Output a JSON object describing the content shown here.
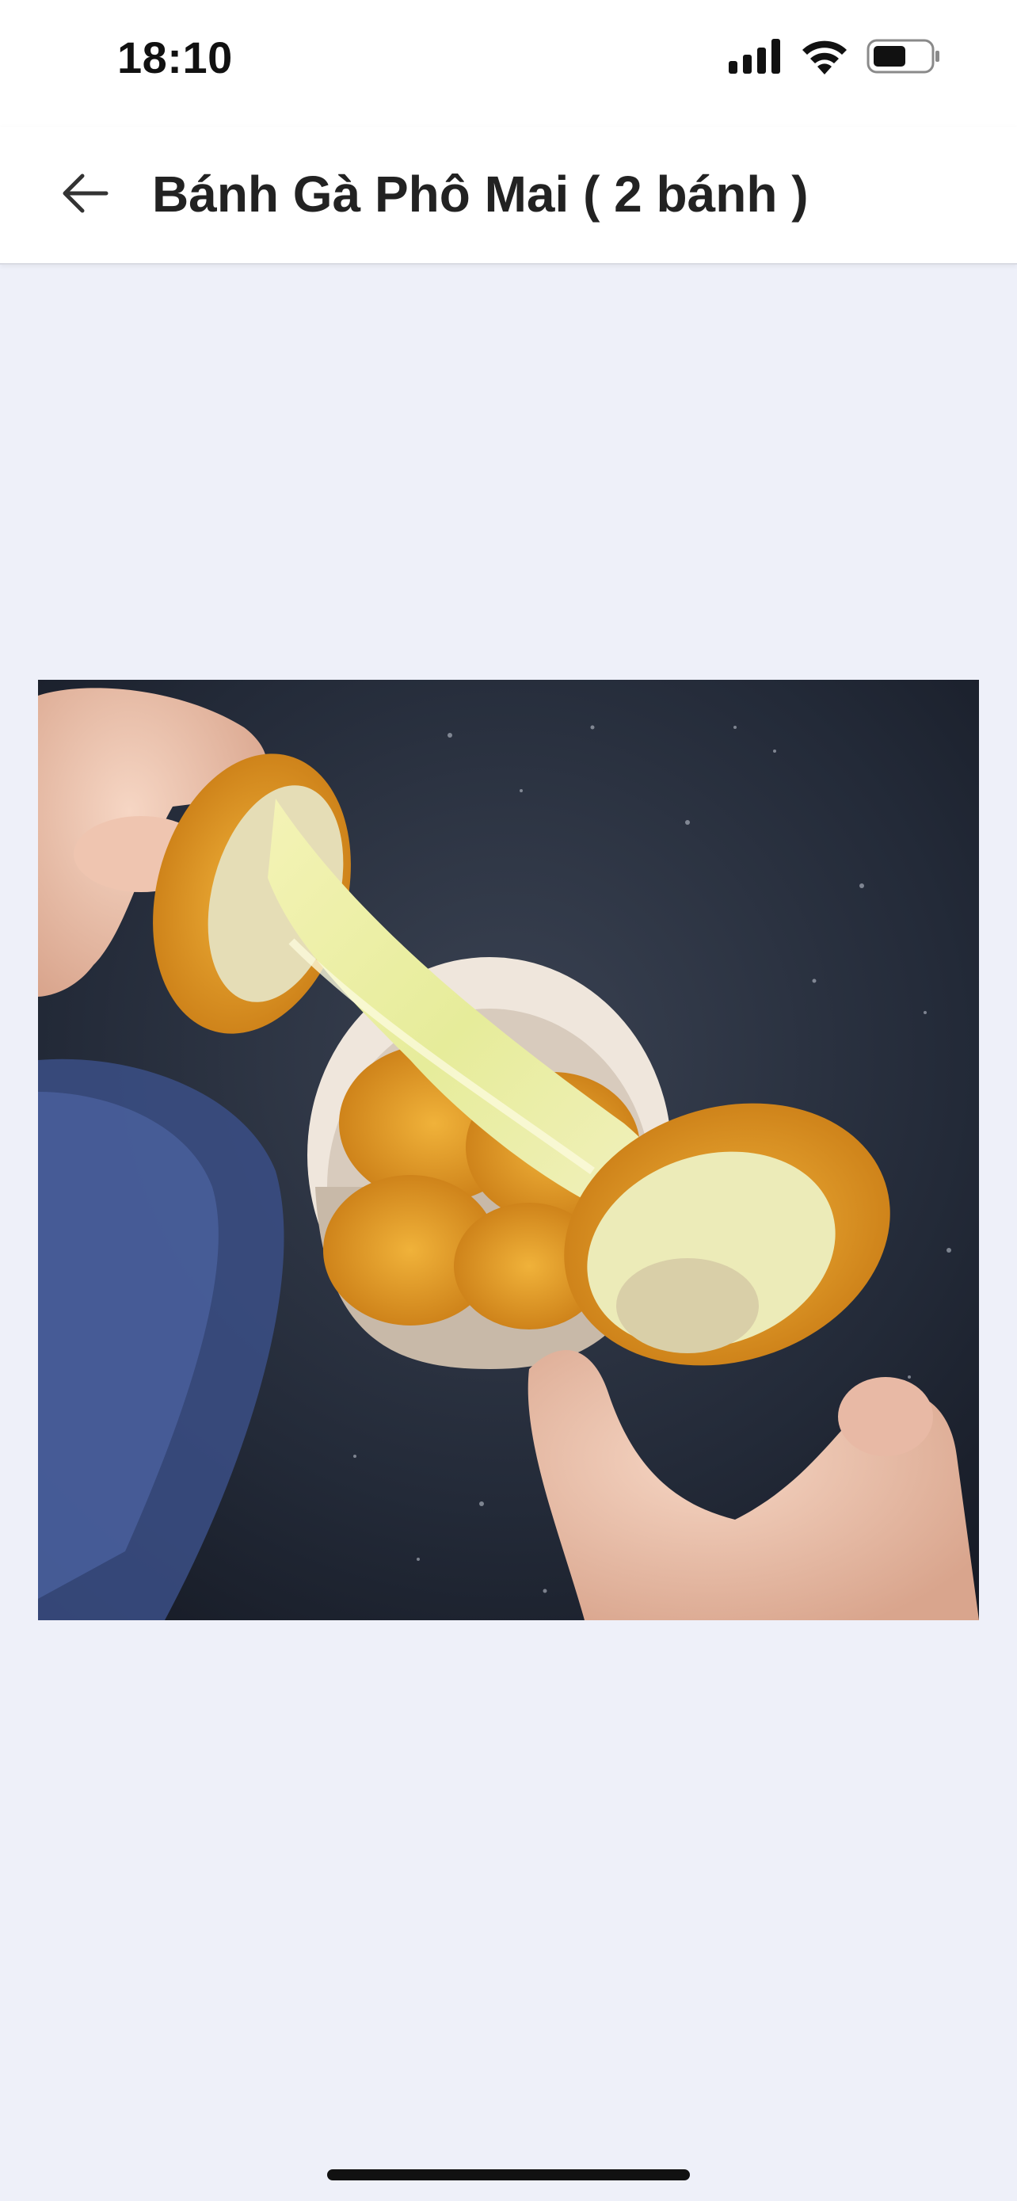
{
  "status_bar": {
    "time": "18:10",
    "icons": [
      "cellular-signal-icon",
      "wifi-icon",
      "battery-icon"
    ]
  },
  "header": {
    "back_icon": "arrow-left-icon",
    "title": "Bánh Gà Phô Mai ( 2 bánh )"
  },
  "colors": {
    "page_background": "#eef0f9",
    "header_background": "#ffffff",
    "title_text": "#222222"
  }
}
